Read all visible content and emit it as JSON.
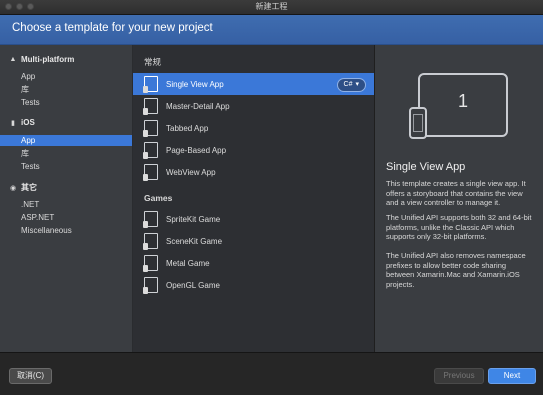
{
  "window": {
    "title": "新建工程"
  },
  "header": {
    "title": "Choose a template for your new project"
  },
  "sidebar": {
    "categories": [
      {
        "label": "Multi-platform",
        "items": [
          "App",
          "库",
          "Tests"
        ]
      },
      {
        "label": "iOS",
        "items": [
          "App",
          "库",
          "Tests"
        ]
      },
      {
        "label": "其它",
        "items": [
          ".NET",
          "ASP.NET",
          "Miscellaneous"
        ]
      }
    ],
    "selected": "iOS / App"
  },
  "templates": {
    "groups": [
      {
        "title": "常规",
        "items": [
          "Single View App",
          "Master-Detail App",
          "Tabbed App",
          "Page-Based App",
          "WebView App"
        ]
      },
      {
        "title": "Games",
        "items": [
          "SpriteKit Game",
          "SceneKit Game",
          "Metal Game",
          "OpenGL Game"
        ]
      }
    ],
    "selected": "Single View App",
    "language": "C#"
  },
  "detail": {
    "preview_number": "1",
    "title": "Single View App",
    "paragraphs": [
      "This template creates a single view app. It offers a storyboard that contains the view and a view controller to manage it.",
      "The Unified API supports both 32 and 64-bit platforms, unlike the Classic API which supports only 32-bit platforms.",
      "The Unified API also removes namespace prefixes to allow better code sharing between Xamarin.Mac and Xamarin.iOS projects."
    ]
  },
  "footer": {
    "cancel_label": "取消(C)",
    "previous_label": "Previous",
    "next_label": "Next"
  },
  "colors": {
    "accent": "#3b78d8",
    "header": "#3a67ab",
    "sidebar_bg": "#3a3d41",
    "list_bg": "#2d2f33"
  }
}
